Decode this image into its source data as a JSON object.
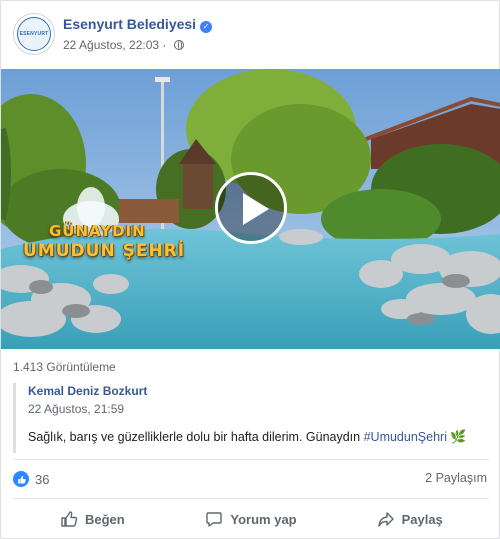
{
  "post": {
    "page_name": "Esenyurt Belediyesi",
    "timestamp": "22 Ağustos, 22:03 ·",
    "avatar_logo_text": "ESENYURT",
    "icons": [
      "verified-icon",
      "globe-icon",
      "play-icon",
      "leaf-icon",
      "like-icon",
      "comment-icon",
      "share-icon"
    ]
  },
  "video": {
    "overlay_line1": "GÜNAYDIN",
    "overlay_line2": "UMUDUN ŞEHRİ",
    "views": "1.413 Görüntüleme"
  },
  "shared_post": {
    "author": "Kemal Deniz Bozkurt",
    "date": "22 Ağustos, 21:59",
    "text": "Sağlık, barış ve güzelliklerle dolu bir hafta dilerim. Günaydın ",
    "hashtag": "#UmudunŞehri",
    "emoji": "🌿"
  },
  "engagement": {
    "reaction_count": "36",
    "shares": "2 Paylaşım"
  },
  "actions": {
    "like": "Beğen",
    "comment": "Yorum yap",
    "share": "Paylaş"
  },
  "colors": {
    "link": "#365899",
    "like_badge": "#2d88ff",
    "secondary_text": "#606770"
  }
}
